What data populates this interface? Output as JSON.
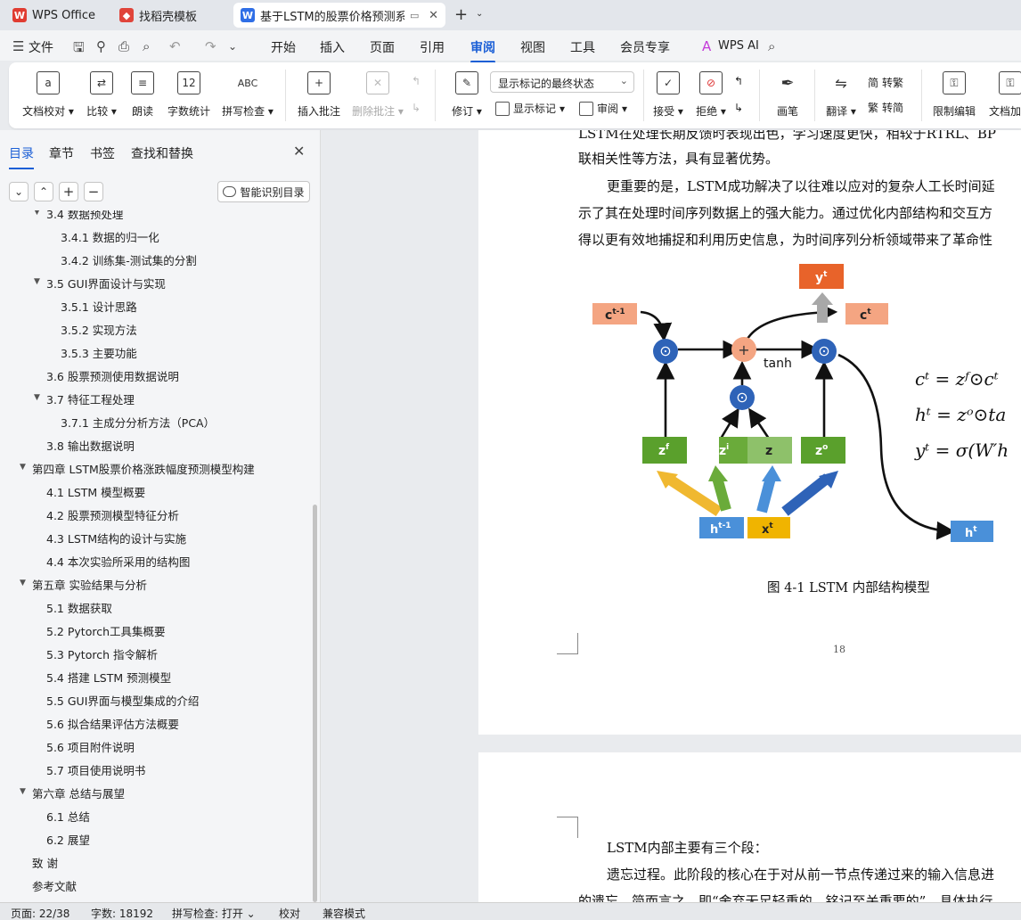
{
  "tabs": [
    {
      "label": "WPS Office",
      "icon": "wps-logo-icon",
      "color": "#e03c31"
    },
    {
      "label": "找稻壳模板",
      "icon": "docer-icon",
      "color": "#e0443a"
    },
    {
      "label": "基于LSTM的股票价格预测系统",
      "icon": "writer-icon",
      "color": "#2f6ee6"
    }
  ],
  "menu": {
    "file": "文件",
    "items": [
      "开始",
      "插入",
      "页面",
      "引用",
      "审阅",
      "视图",
      "工具",
      "会员专享"
    ],
    "active": "审阅",
    "wps_ai": "WPS AI"
  },
  "ribbon": {
    "buttons": [
      {
        "label": "文档校对",
        "arrow": true
      },
      {
        "label": "比较",
        "arrow": true
      },
      {
        "label": "朗读"
      },
      {
        "label": "字数统计"
      },
      {
        "label": "拼写检查",
        "arrow": true
      },
      {
        "label": "插入批注"
      },
      {
        "label": "删除批注",
        "arrow": true,
        "disabled": true
      },
      {
        "label": "修订",
        "arrow": true
      },
      {
        "label": "接受",
        "arrow": true
      },
      {
        "label": "拒绝",
        "arrow": true
      },
      {
        "label": "画笔"
      },
      {
        "label": "翻译",
        "arrow": true
      },
      {
        "label": "限制编辑"
      },
      {
        "label": "文档加密"
      }
    ],
    "markup_select": "显示标记的最终状态",
    "show_markup": "显示标记",
    "review_pane": "审阅",
    "to_traditional": "转繁",
    "to_simplified": "转简",
    "count_icon_text": "12",
    "spell_icon_text": "ABC"
  },
  "leftpane": {
    "tabs": [
      "目录",
      "章节",
      "书签",
      "查找和替换"
    ],
    "smart_toc": "智能识别目录",
    "toc": [
      {
        "text": "3.4 数据预处理",
        "level": 2,
        "arrow": true
      },
      {
        "text": "3.4.1 数据的归一化",
        "level": 3
      },
      {
        "text": "3.4.2 训练集-测试集的分割",
        "level": 3
      },
      {
        "text": "3.5 GUI界面设计与实现",
        "level": 2,
        "arrow": true
      },
      {
        "text": "3.5.1 设计思路",
        "level": 3
      },
      {
        "text": "3.5.2 实现方法",
        "level": 3
      },
      {
        "text": "3.5.3 主要功能",
        "level": 3
      },
      {
        "text": "3.6 股票预测使用数据说明",
        "level": 2
      },
      {
        "text": "3.7 特征工程处理",
        "level": 2,
        "arrow": true
      },
      {
        "text": "3.7.1 主成分分析方法（PCA）",
        "level": 3
      },
      {
        "text": "3.8 输出数据说明",
        "level": 2
      },
      {
        "text": "第四章 LSTM股票价格涨跌幅度预测模型构建",
        "level": 1,
        "arrow": true
      },
      {
        "text": "4.1 LSTM 模型概要",
        "level": 2
      },
      {
        "text": "4.2 股票预测模型特征分析",
        "level": 2
      },
      {
        "text": "4.3 LSTM结构的设计与实施",
        "level": 2
      },
      {
        "text": "4.4 本次实验所采用的结构图",
        "level": 2
      },
      {
        "text": "第五章 实验结果与分析",
        "level": 1,
        "arrow": true
      },
      {
        "text": "5.1 数据获取",
        "level": 2
      },
      {
        "text": "5.2 Pytorch工具集概要",
        "level": 2
      },
      {
        "text": "5.3 Pytorch 指令解析",
        "level": 2
      },
      {
        "text": "5.4 搭建 LSTM 预测模型",
        "level": 2
      },
      {
        "text": "5.5 GUI界面与模型集成的介绍",
        "level": 2
      },
      {
        "text": "5.6 拟合结果评估方法概要",
        "level": 2
      },
      {
        "text": "5.6 项目附件说明",
        "level": 2
      },
      {
        "text": "5.7 项目使用说明书",
        "level": 2
      },
      {
        "text": "第六章 总结与展望",
        "level": 1,
        "arrow": true
      },
      {
        "text": "6.1 总结",
        "level": 2
      },
      {
        "text": "6.2 展望",
        "level": 2
      },
      {
        "text": "致  谢",
        "level": 1
      },
      {
        "text": "参考文献",
        "level": 1
      }
    ]
  },
  "document": {
    "lines": [
      "LSTM在处理长期反馈时表现出色，学习速度更快，相较于RTRL、BP",
      "联相关性等方法，具有显著优势。",
      "更重要的是，LSTM成功解决了以往难以应对的复杂人工长时间延",
      "示了其在处理时间序列数据上的强大能力。通过优化内部结构和交互方",
      "得以更有效地捕捉和利用历史信息，为时间序列分析领域带来了革命性"
    ],
    "figure": {
      "labels": {
        "c_prev": "c",
        "c_prev_sup": "t-1",
        "c_t": "c",
        "c_t_sup": "t",
        "y_t": "y",
        "y_t_sup": "t",
        "h_t": "h",
        "h_t_sup": "t",
        "h_prev": "h",
        "h_prev_sup": "t-1",
        "x_t": "x",
        "x_t_sup": "t",
        "zf": "z",
        "zf_sup": "f",
        "zi": "z",
        "zi_sup": "i",
        "z": "z",
        "zo": "z",
        "zo_sup": "o",
        "tanh": "tanh"
      },
      "equations": [
        "cᵗ = zᶠ⊙cᵗ",
        "hᵗ = zᵒ⊙ta",
        "yᵗ = σ(W′h"
      ]
    },
    "caption": "图 4-1  LSTM 内部结构模型",
    "page_number": "18",
    "page2_lines": [
      "LSTM内部主要有三个段：",
      "遗忘过程。此阶段的核心在于对从前一节点传递过来的输入信息进",
      "的遗忘，简而言之，即“舍弃无足轻重的，铭记至关重要的”。具体执行"
    ]
  },
  "status": {
    "page": "页面: 22/38",
    "words": "字数: 18192",
    "spell": "拼写检查: 打开",
    "proof": "校对",
    "compat": "兼容模式"
  },
  "colors": {
    "accent": "#1b5fd6",
    "orange": "#f4a582",
    "green": "#5aa02c",
    "blue_gate": "#2e63b8",
    "blue_box": "#4a90d9",
    "yellow_box": "#f0b400",
    "red_box": "#e8632a"
  }
}
